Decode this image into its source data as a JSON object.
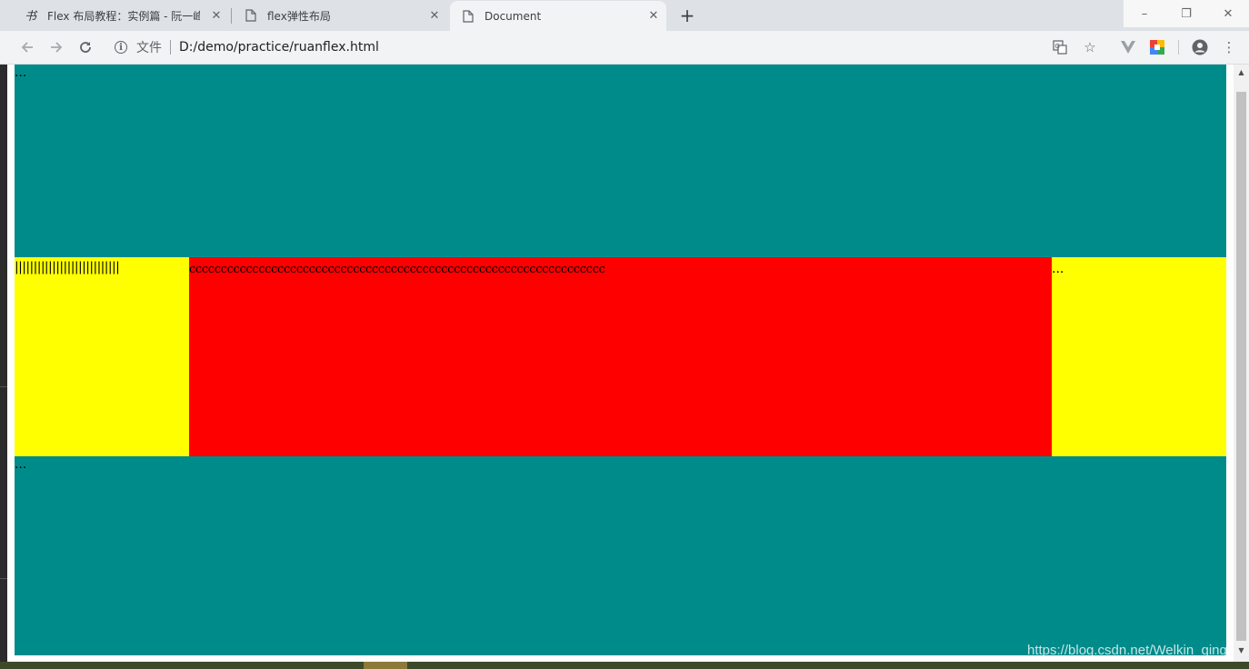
{
  "browser": {
    "tabs": [
      {
        "title": "Flex 布局教程：实例篇 - 阮一峰的",
        "icon": "ruanyifeng-favicon",
        "active": false
      },
      {
        "title": "flex弹性布局",
        "icon": "file-icon",
        "active": false
      },
      {
        "title": "Document",
        "icon": "file-icon",
        "active": true
      }
    ],
    "new_tab": "+",
    "window_controls": {
      "minimize": "–",
      "restore": "❐",
      "close": "✕"
    },
    "address": {
      "scheme_label": "文件",
      "url": "D:/demo/practice/ruanflex.html"
    }
  },
  "page": {
    "header_text": "...",
    "nav_text": "||||||||||||||||||||||||||||",
    "content_text": "cccccccccccccccccccccccccccccccccccccccccccccccccccccccccccccccccc",
    "ads_text": "...",
    "footer_text": "...",
    "colors": {
      "header": "#008b8b",
      "nav": "#ffff00",
      "content": "#ff0000",
      "ads": "#ffff00",
      "footer": "#008b8b"
    }
  },
  "watermark": "https://blog.csdn.net/Welkin_qing"
}
